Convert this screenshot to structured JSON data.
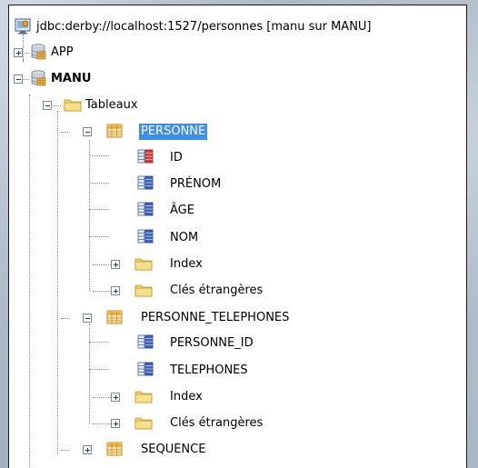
{
  "tree": {
    "connection": {
      "label": "jdbc:derby://localhost:1527/personnes [manu sur MANU]",
      "icon": "database-connection-icon"
    },
    "schema_app": {
      "label": "APP",
      "icon": "database-schema-icon",
      "expanded": false
    },
    "schema_manu": {
      "label": "MANU",
      "icon": "database-schema-icon",
      "expanded": true
    },
    "tables_folder": {
      "label": "Tableaux",
      "icon": "folder-icon",
      "expanded": true
    },
    "table_personne": {
      "label": "PERSONNE",
      "icon": "table-icon",
      "expanded": true,
      "selected": true,
      "columns": [
        {
          "label": "ID",
          "icon": "primary-key-column-icon"
        },
        {
          "label": "PRÉNOM",
          "icon": "column-icon"
        },
        {
          "label": "ÂGE",
          "icon": "column-icon"
        },
        {
          "label": "NOM",
          "icon": "column-icon"
        }
      ],
      "index_label": "Index",
      "fk_label": "Clés étrangères"
    },
    "table_personne_telephones": {
      "label": "PERSONNE_TELEPHONES",
      "icon": "table-icon",
      "expanded": true,
      "columns": [
        {
          "label": "PERSONNE_ID",
          "icon": "column-icon"
        },
        {
          "label": "TELEPHONES",
          "icon": "column-icon"
        }
      ],
      "index_label": "Index",
      "fk_label": "Clés étrangères"
    },
    "table_sequence": {
      "label": "SEQUENCE",
      "icon": "table-icon",
      "expanded": false
    }
  },
  "colors": {
    "selection": "#3d8ee6",
    "folder": "#f2d36b",
    "table": "#f0b84a",
    "column_blue": "#3f63b8",
    "key_red": "#d63b32"
  }
}
